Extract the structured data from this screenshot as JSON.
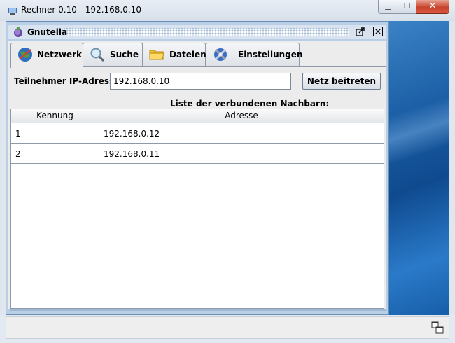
{
  "window": {
    "title": "Rechner 0.10 - 192.168.0.10",
    "icon": "app-icon"
  },
  "internal_frame": {
    "title": "Gnutella",
    "icon": "gnutella-globe-icon"
  },
  "tabs": [
    {
      "label": "Netzwerk",
      "icon": "network-globe-icon",
      "active": true
    },
    {
      "label": "Suche",
      "icon": "magnifier-icon",
      "active": false
    },
    {
      "label": "Dateien",
      "icon": "folder-icon",
      "active": false
    },
    {
      "label": "Einstellungen",
      "icon": "tools-icon",
      "active": false
    }
  ],
  "network": {
    "ip_label": "Teilnehmer IP-Adresse:",
    "ip_value": "192.168.0.10",
    "join_button": "Netz beitreten",
    "list_caption": "Liste der verbundenen Nachbarn:",
    "columns": [
      "Kennung",
      "Adresse"
    ],
    "rows": [
      {
        "id": "1",
        "address": "192.168.0.12"
      },
      {
        "id": "2",
        "address": "192.168.0.11"
      }
    ]
  },
  "colors": {
    "desktop": "#1c5fa6",
    "close_button": "#c7432b",
    "frame": "#b8cfe5"
  }
}
